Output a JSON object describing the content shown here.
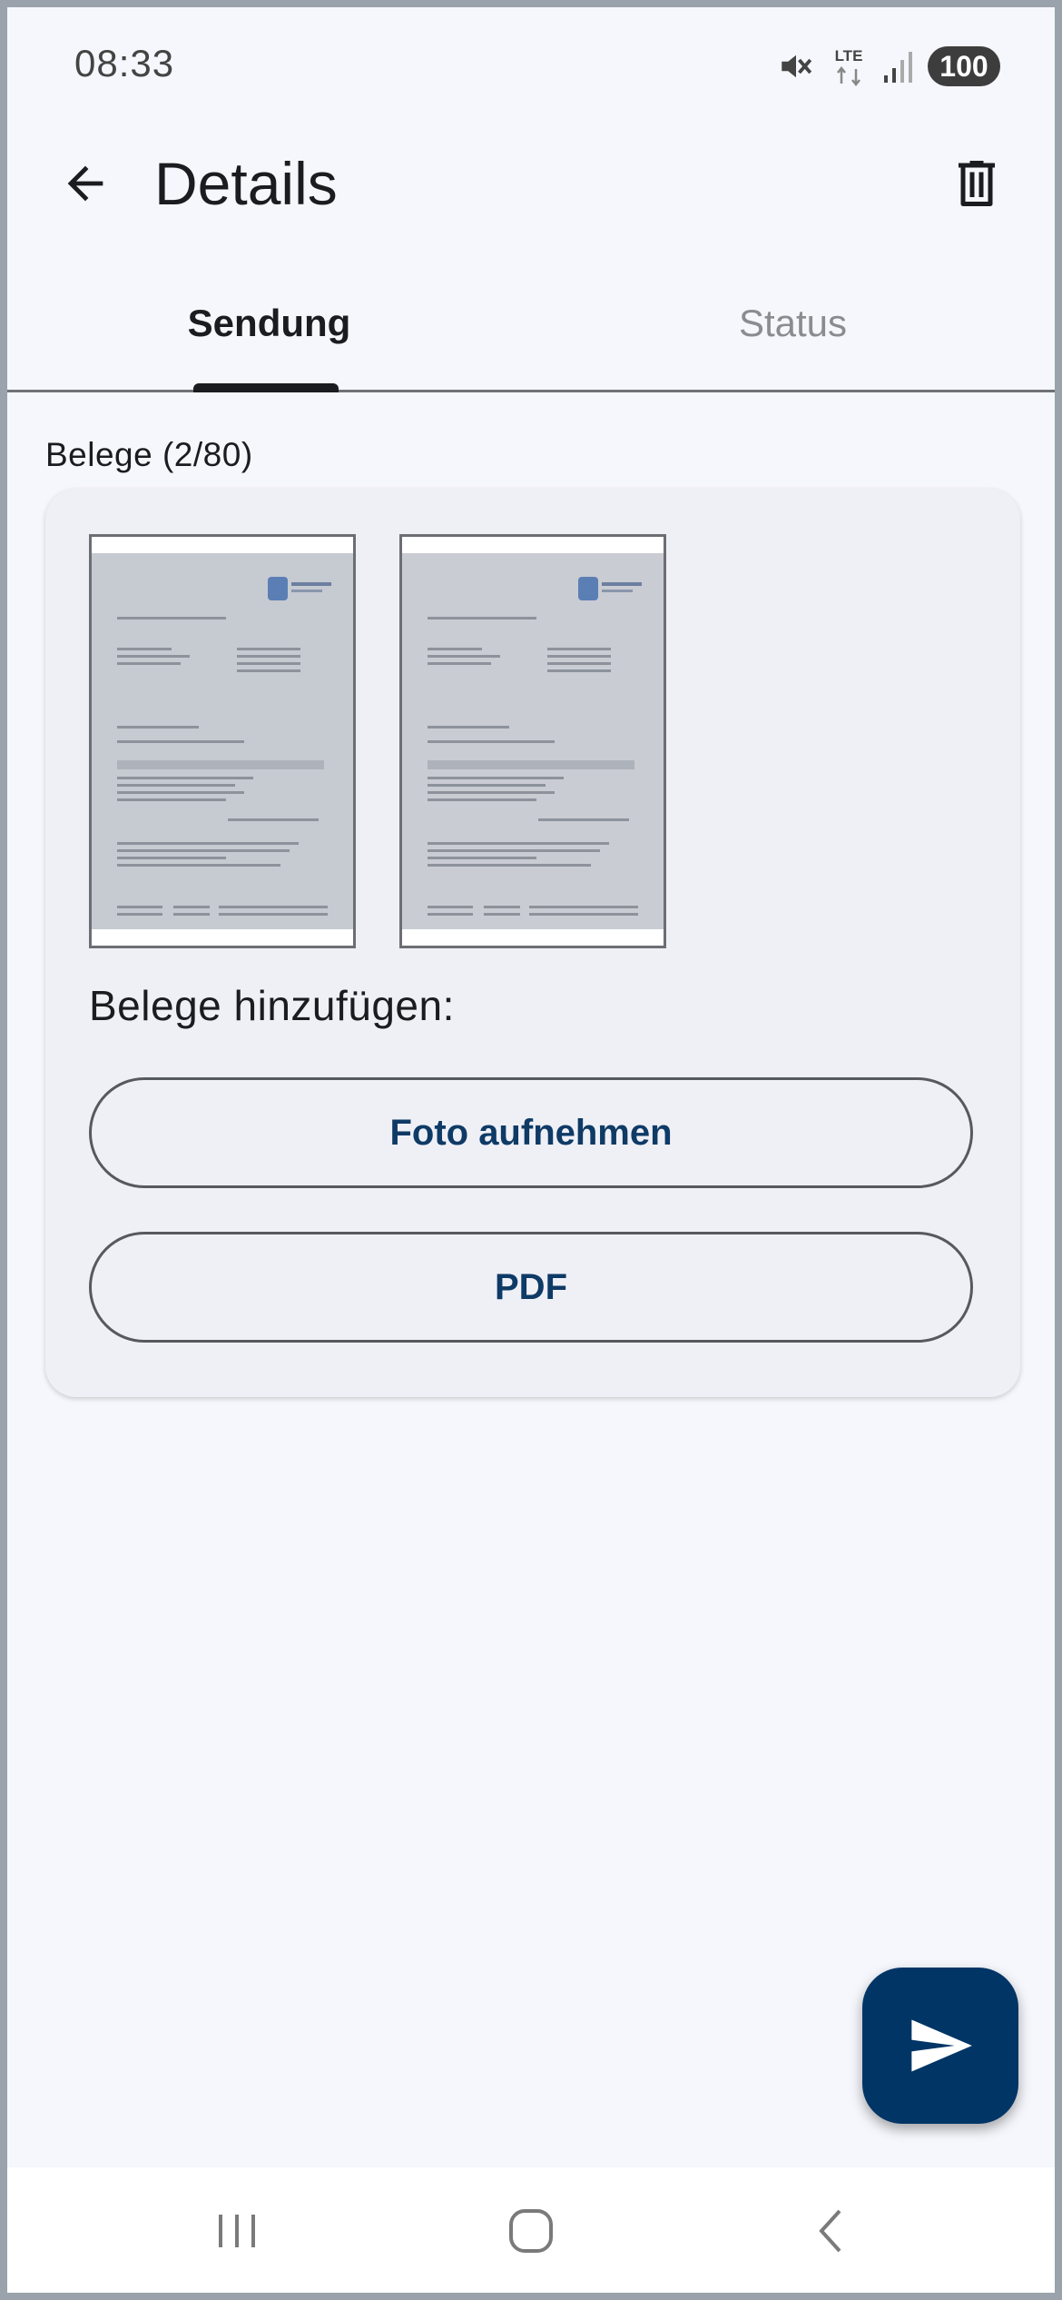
{
  "status_bar": {
    "time": "08:33",
    "network_label": "LTE",
    "battery": "100",
    "icons": [
      "mute-icon",
      "lte-icon",
      "signal-icon",
      "battery-icon"
    ]
  },
  "app_bar": {
    "title": "Details",
    "back_icon": "arrow-left-icon",
    "delete_icon": "trash-icon"
  },
  "tabs": [
    {
      "label": "Sendung",
      "selected": true
    },
    {
      "label": "Status",
      "selected": false
    }
  ],
  "belege": {
    "label": "Belege (2/80)",
    "thumbnails": [
      {
        "type": "document-scan"
      },
      {
        "type": "document-scan"
      }
    ],
    "add_heading": "Belege hinzufügen:",
    "buttons": {
      "photo": "Foto aufnehmen",
      "pdf": "PDF"
    }
  },
  "fab": {
    "icon": "send-icon"
  },
  "nav_bar": {
    "items": [
      "recents-icon",
      "home-icon",
      "back-chevron-icon"
    ]
  },
  "colors": {
    "accent": "#003566",
    "button_text": "#0e3a66",
    "background": "#f6f7fc",
    "card": "#eff0f6"
  }
}
